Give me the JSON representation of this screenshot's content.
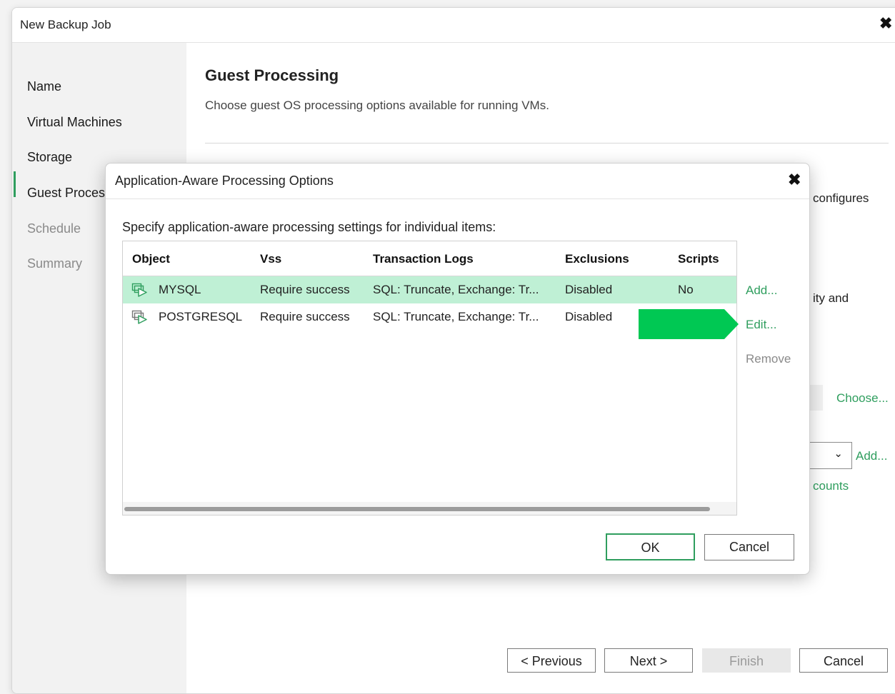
{
  "window": {
    "title": "New Backup Job",
    "close_glyph": "✖"
  },
  "sidebar": {
    "items": [
      {
        "label": "Name",
        "state": "done"
      },
      {
        "label": "Virtual Machines",
        "state": "done"
      },
      {
        "label": "Storage",
        "state": "done"
      },
      {
        "label": "Guest Proces",
        "state": "active"
      },
      {
        "label": "Schedule",
        "state": "disabled"
      },
      {
        "label": "Summary",
        "state": "disabled"
      }
    ]
  },
  "main": {
    "title": "Guest Processing",
    "description": "Choose guest OS processing options available for running VMs.",
    "partial_texts": {
      "configures": "configures",
      "ity_and": "ity and",
      "counts": "counts"
    },
    "choose_link": "Choose...",
    "add_link": "Add...",
    "select_chevron": "⌄"
  },
  "footer": {
    "previous": "< Previous",
    "next": "Next >",
    "finish": "Finish",
    "cancel": "Cancel"
  },
  "dialog": {
    "title": "Application-Aware Processing Options",
    "close_glyph": "✖",
    "instruction": "Specify application-aware processing settings for individual items:",
    "columns": [
      "Object",
      "Vss",
      "Transaction Logs",
      "Exclusions",
      "Scripts"
    ],
    "rows": [
      {
        "object": "MYSQL",
        "vss": "Require success",
        "logs": "SQL: Truncate, Exchange: Tr...",
        "exclusions": "Disabled",
        "scripts": "No",
        "selected": true
      },
      {
        "object": "POSTGRESQL",
        "vss": "Require success",
        "logs": "SQL: Truncate, Exchange: Tr...",
        "exclusions": "Disabled",
        "scripts": "",
        "selected": false
      }
    ],
    "actions": {
      "add": "Add...",
      "edit": "Edit...",
      "remove": "Remove"
    },
    "ok": "OK",
    "cancel": "Cancel"
  },
  "colors": {
    "accent": "#2f9e5e",
    "selection": "#bff0d5",
    "highlight_arrow": "#00c853"
  }
}
